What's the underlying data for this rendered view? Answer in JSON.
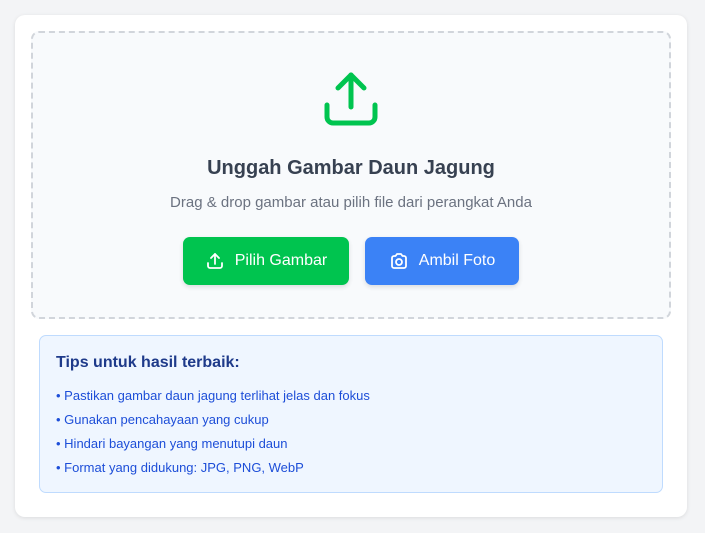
{
  "upload": {
    "title": "Unggah Gambar Daun Jagung",
    "subtitle": "Drag & drop gambar atau pilih file dari perangkat Anda",
    "pick_button_label": "Pilih Gambar",
    "camera_button_label": "Ambil Foto",
    "icon": "upload-icon",
    "pick_icon": "upload-icon",
    "camera_icon": "camera-icon"
  },
  "tips": {
    "title": "Tips untuk hasil terbaik:",
    "items": [
      "Pastikan gambar daun jagung terlihat jelas dan fokus",
      "Gunakan pencahayaan yang cukup",
      "Hindari bayangan yang menutupi daun",
      "Format yang didukung: JPG, PNG, WebP"
    ]
  },
  "colors": {
    "accent_green": "#00c44f",
    "accent_blue": "#3b82f6",
    "tips_background": "#eff6ff",
    "tips_text": "#1d4ed8"
  }
}
